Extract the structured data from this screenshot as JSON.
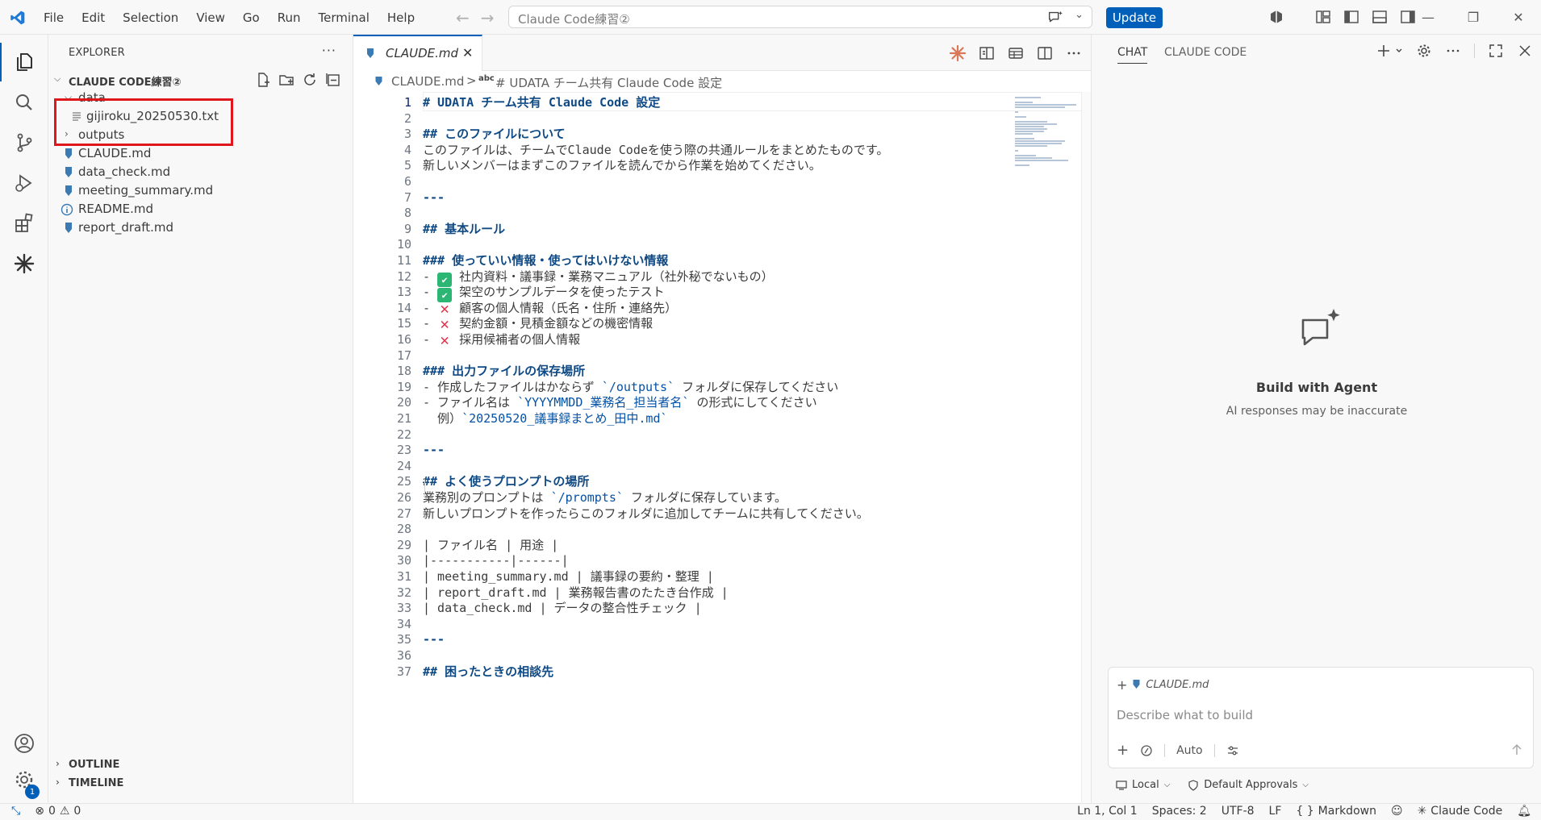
{
  "titlebar": {
    "menu": [
      "File",
      "Edit",
      "Selection",
      "View",
      "Go",
      "Run",
      "Terminal",
      "Help"
    ],
    "search_text": "Claude Code練習②",
    "update_label": "Update"
  },
  "activity_bar": {
    "items": [
      "explorer-icon",
      "search-icon",
      "source-control-icon",
      "run-debug-icon",
      "extensions-icon",
      "claude-icon"
    ],
    "accounts": "account-icon",
    "manage_badge": "1"
  },
  "sidebar": {
    "title": "EXPLORER",
    "more": "···",
    "root_label": "CLAUDE CODE練習②",
    "tree": [
      {
        "label": "data",
        "type": "folder",
        "expanded": true,
        "depth": 0
      },
      {
        "label": "gijiroku_20250530.txt",
        "type": "txt",
        "depth": 1
      },
      {
        "label": "outputs",
        "type": "folder",
        "expanded": false,
        "depth": 0
      },
      {
        "label": "CLAUDE.md",
        "type": "md",
        "depth": 0
      },
      {
        "label": "data_check.md",
        "type": "md",
        "depth": 0
      },
      {
        "label": "meeting_summary.md",
        "type": "md",
        "depth": 0
      },
      {
        "label": "README.md",
        "type": "info",
        "depth": 0
      },
      {
        "label": "report_draft.md",
        "type": "md",
        "depth": 0
      }
    ],
    "outline_label": "OUTLINE",
    "timeline_label": "TIMELINE"
  },
  "editor": {
    "tab_label": "CLAUDE.md",
    "breadcrumb_file": "CLAUDE.md",
    "breadcrumb_sep": ">",
    "breadcrumb_symbol_kind": "abc",
    "breadcrumb_symbol": "# UDATA チーム共有 Claude Code 設定",
    "lines": [
      {
        "n": "1",
        "segs": [
          {
            "t": "# UDATA チーム共有 Claude Code 設定",
            "c": "h"
          }
        ]
      },
      {
        "n": "2",
        "segs": []
      },
      {
        "n": "3",
        "segs": [
          {
            "t": "## このファイルについて",
            "c": "h"
          }
        ]
      },
      {
        "n": "4",
        "segs": [
          {
            "t": "このファイルは、チームでClaude Codeを使う際の共通ルールをまとめたものです。",
            "c": ""
          }
        ]
      },
      {
        "n": "5",
        "segs": [
          {
            "t": "新しいメンバーはまずこのファイルを読んでから作業を始めてください。",
            "c": ""
          }
        ]
      },
      {
        "n": "6",
        "segs": []
      },
      {
        "n": "7",
        "segs": [
          {
            "t": "---",
            "c": "h"
          }
        ]
      },
      {
        "n": "8",
        "segs": []
      },
      {
        "n": "9",
        "segs": [
          {
            "t": "## 基本ルール",
            "c": "h"
          }
        ]
      },
      {
        "n": "10",
        "segs": []
      },
      {
        "n": "11",
        "segs": [
          {
            "t": "### 使っていい情報・使ってはいけない情報",
            "c": "h"
          }
        ]
      },
      {
        "n": "12",
        "segs": [
          {
            "t": "- ",
            "c": ""
          },
          {
            "t": "✔",
            "c": "ok"
          },
          {
            "t": " 社内資料・議事録・業務マニュアル（社外秘でないもの）",
            "c": ""
          }
        ]
      },
      {
        "n": "13",
        "segs": [
          {
            "t": "- ",
            "c": ""
          },
          {
            "t": "✔",
            "c": "ok"
          },
          {
            "t": " 架空のサンプルデータを使ったテスト",
            "c": ""
          }
        ]
      },
      {
        "n": "14",
        "segs": [
          {
            "t": "- ",
            "c": ""
          },
          {
            "t": "✕",
            "c": "ng"
          },
          {
            "t": " 顧客の個人情報（氏名・住所・連絡先）",
            "c": ""
          }
        ]
      },
      {
        "n": "15",
        "segs": [
          {
            "t": "- ",
            "c": ""
          },
          {
            "t": "✕",
            "c": "ng"
          },
          {
            "t": " 契約金額・見積金額などの機密情報",
            "c": ""
          }
        ]
      },
      {
        "n": "16",
        "segs": [
          {
            "t": "- ",
            "c": ""
          },
          {
            "t": "✕",
            "c": "ng"
          },
          {
            "t": " 採用候補者の個人情報",
            "c": ""
          }
        ]
      },
      {
        "n": "17",
        "segs": []
      },
      {
        "n": "18",
        "segs": [
          {
            "t": "### 出力ファイルの保存場所",
            "c": "h"
          }
        ]
      },
      {
        "n": "19",
        "segs": [
          {
            "t": "- 作成したファイルはかならず ",
            "c": ""
          },
          {
            "t": "`/outputs`",
            "c": "mk"
          },
          {
            "t": " フォルダに保存してください",
            "c": ""
          }
        ]
      },
      {
        "n": "20",
        "segs": [
          {
            "t": "- ファイル名は ",
            "c": ""
          },
          {
            "t": "`YYYYMMDD_業務名_担当者名`",
            "c": "mk"
          },
          {
            "t": " の形式にしてください",
            "c": ""
          }
        ]
      },
      {
        "n": "21",
        "segs": [
          {
            "t": "  例）",
            "c": ""
          },
          {
            "t": "`20250520_議事録まとめ_田中.md`",
            "c": "mk"
          }
        ]
      },
      {
        "n": "22",
        "segs": []
      },
      {
        "n": "23",
        "segs": [
          {
            "t": "---",
            "c": "h"
          }
        ]
      },
      {
        "n": "24",
        "segs": []
      },
      {
        "n": "25",
        "segs": [
          {
            "t": "## よく使うプロンプトの場所",
            "c": "h"
          }
        ]
      },
      {
        "n": "26",
        "segs": [
          {
            "t": "業務別のプロンプトは ",
            "c": ""
          },
          {
            "t": "`/prompts`",
            "c": "mk"
          },
          {
            "t": " フォルダに保存しています。",
            "c": ""
          }
        ]
      },
      {
        "n": "27",
        "segs": [
          {
            "t": "新しいプロンプトを作ったらこのフォルダに追加してチームに共有してください。",
            "c": ""
          }
        ]
      },
      {
        "n": "28",
        "segs": []
      },
      {
        "n": "29",
        "segs": [
          {
            "t": "| ファイル名 | 用途 |",
            "c": ""
          }
        ]
      },
      {
        "n": "30",
        "segs": [
          {
            "t": "|-----------|------|",
            "c": ""
          }
        ]
      },
      {
        "n": "31",
        "segs": [
          {
            "t": "| meeting_summary.md | 議事録の要約・整理 |",
            "c": ""
          }
        ]
      },
      {
        "n": "32",
        "segs": [
          {
            "t": "| report_draft.md | 業務報告書のたたき台作成 |",
            "c": ""
          }
        ]
      },
      {
        "n": "33",
        "segs": [
          {
            "t": "| data_check.md | データの整合性チェック |",
            "c": ""
          }
        ]
      },
      {
        "n": "34",
        "segs": []
      },
      {
        "n": "35",
        "segs": [
          {
            "t": "---",
            "c": "h"
          }
        ]
      },
      {
        "n": "36",
        "segs": []
      },
      {
        "n": "37",
        "segs": [
          {
            "t": "## 困ったときの相談先",
            "c": "h"
          }
        ]
      }
    ]
  },
  "chat": {
    "tabs": [
      "CHAT",
      "CLAUDE CODE"
    ],
    "title": "Build with Agent",
    "subtitle": "AI responses may be inaccurate",
    "context_file": "CLAUDE.md",
    "input_placeholder": "Describe what to build",
    "mode_label": "Auto",
    "footer_local": "Local",
    "footer_approvals": "Default Approvals"
  },
  "statusbar": {
    "errors": "0",
    "warnings": "0",
    "position": "Ln 1, Col 1",
    "spaces": "Spaces: 2",
    "encoding": "UTF-8",
    "eol": "LF",
    "language": "Markdown",
    "claude": "Claude Code"
  },
  "colors": {
    "accent": "#005fb8",
    "highlight_box": "#e0161d",
    "heading": "#0f4a85",
    "inline_code": "#0451a5"
  }
}
